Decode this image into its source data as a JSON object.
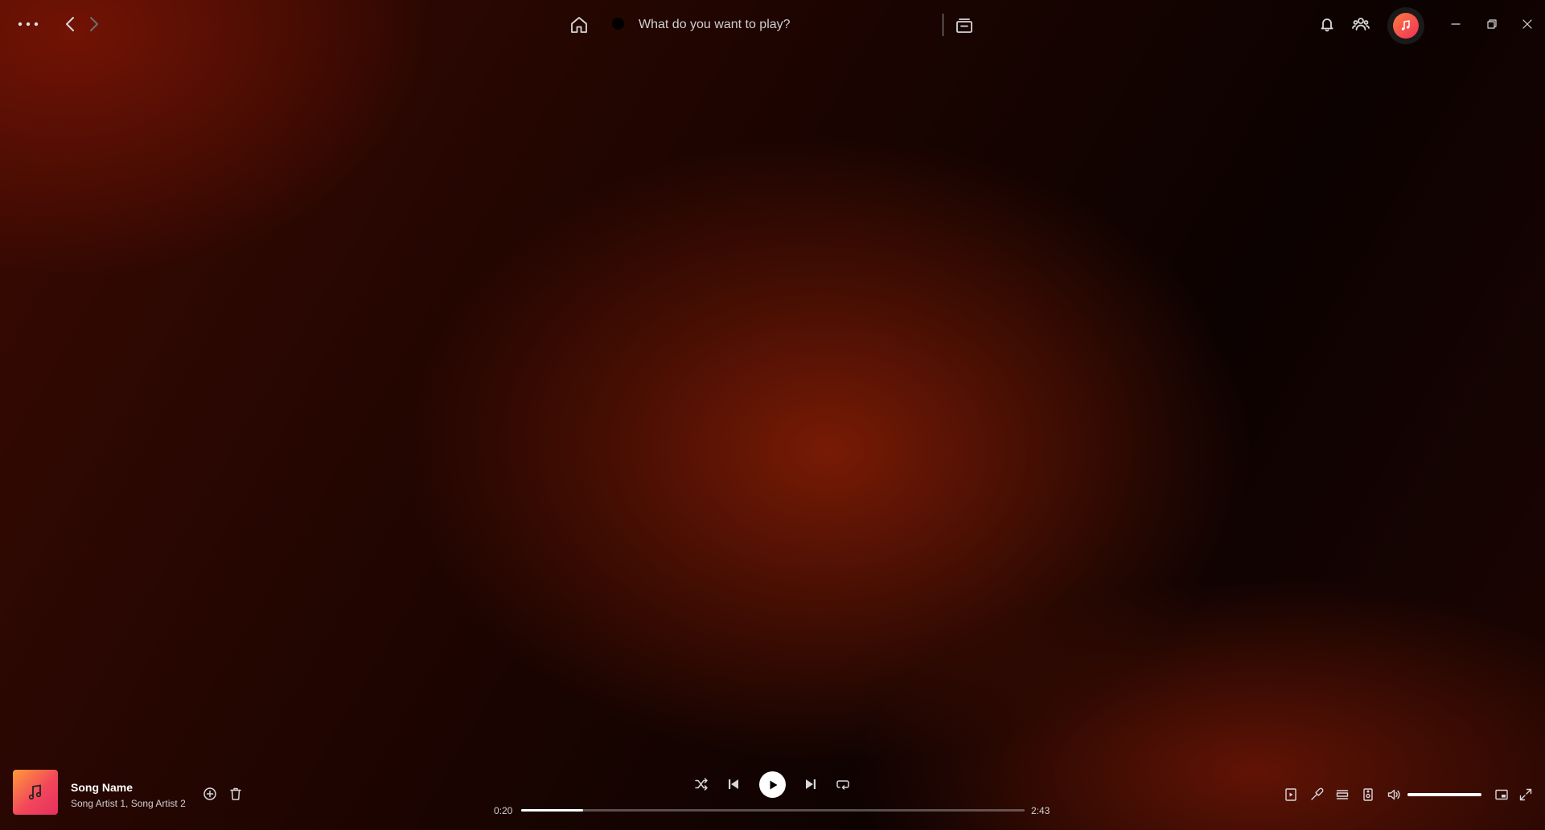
{
  "search": {
    "placeholder": "What do you want to play?"
  },
  "icons": {
    "more": "more-dots-icon",
    "back": "chevron-left-icon",
    "forward": "chevron-right-icon",
    "home": "home-icon",
    "search": "search-icon",
    "browse": "browse-icon",
    "notifications": "bell-icon",
    "friends": "friends-icon",
    "avatar": "music-note-icon",
    "minimize": "minimize-icon",
    "maximize": "restore-icon",
    "close": "close-icon"
  },
  "player": {
    "track": {
      "title": "Song Name",
      "artists": "Song Artist 1, Song Artist 2"
    },
    "elapsed": "0:20",
    "duration": "2:43",
    "progress_fraction": 0.123,
    "volume_fraction": 1.0,
    "is_playing": false
  },
  "colors": {
    "accent_gradient_start": "#ff9a3a",
    "accent_gradient_end": "#e6305e",
    "background_glow": "#7d1c05"
  }
}
